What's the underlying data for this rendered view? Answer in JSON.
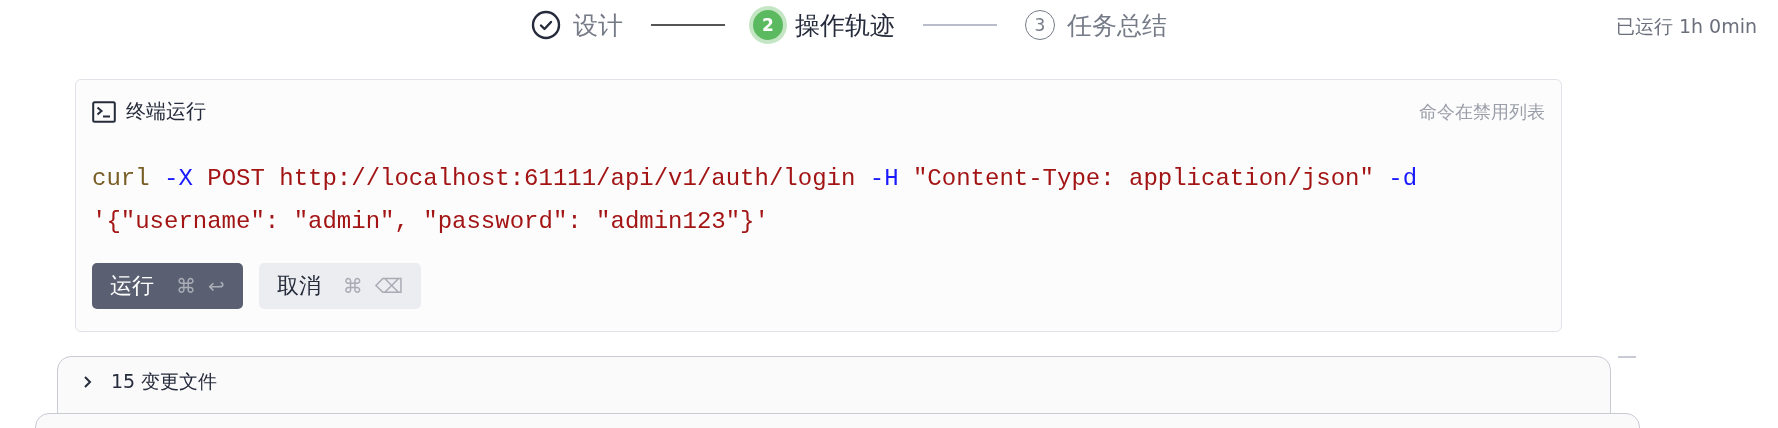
{
  "steps": [
    {
      "kind": "done",
      "label": "设计"
    },
    {
      "kind": "active",
      "number": "2",
      "label": "操作轨迹"
    },
    {
      "kind": "pending",
      "number": "3",
      "label": "任务总结"
    }
  ],
  "elapsed": "已运行 1h 0min",
  "terminal": {
    "title": "终端运行",
    "notice": "命令在禁用列表",
    "lines": [
      [
        {
          "kind": "command",
          "text": "curl"
        },
        {
          "kind": "flag",
          "text": "-X"
        },
        {
          "kind": "string",
          "text": "POST http://localhost:61111/api/v1/auth/login"
        },
        {
          "kind": "flag",
          "text": "-H"
        },
        {
          "kind": "string",
          "text": "\"Content-Type: application/json\""
        },
        {
          "kind": "flag",
          "text": "-d"
        }
      ],
      [
        {
          "kind": "string",
          "text": "'{\"username\": \"admin\", \"password\": \"admin123\"}'"
        }
      ]
    ],
    "buttons": [
      {
        "kind": "primary",
        "label": "运行",
        "keys": [
          "⌘",
          "↩"
        ]
      },
      {
        "kind": "secondary",
        "label": "取消",
        "keys": [
          "⌘",
          "⌫"
        ]
      }
    ]
  },
  "changes": {
    "expanded": false,
    "label": "15 变更文件"
  }
}
